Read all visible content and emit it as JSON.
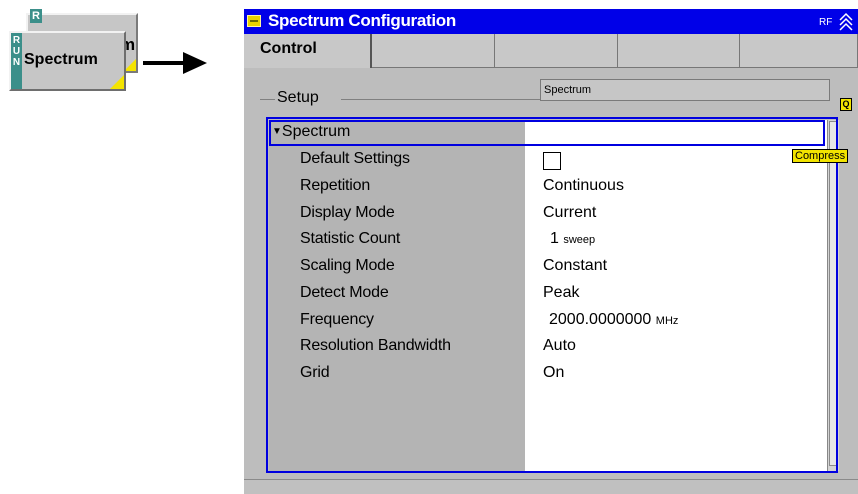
{
  "softkey": {
    "back_tail": "m",
    "back_letter": "R",
    "run_letters": [
      "R",
      "U",
      "N"
    ],
    "label": "Spectrum"
  },
  "window": {
    "title": "Spectrum Configuration",
    "rf_label": "RF",
    "tabs": [
      "Control",
      "",
      "",
      "",
      ""
    ]
  },
  "setup": {
    "label": "Setup",
    "value": "Spectrum",
    "q_badge": "Q"
  },
  "tree": {
    "node_label": "Spectrum",
    "compress_label": "Compress",
    "rows": [
      {
        "label": "Default Settings",
        "value": ""
      },
      {
        "label": "Repetition",
        "value": "Continuous"
      },
      {
        "label": "Display Mode",
        "value": "Current"
      },
      {
        "label": "Statistic Count",
        "value": "1",
        "unit": "sweep"
      },
      {
        "label": "Scaling Mode",
        "value": "Constant"
      },
      {
        "label": "Detect Mode",
        "value": "Peak"
      },
      {
        "label": "Frequency",
        "value": "2000.0000000",
        "unit": "MHz"
      },
      {
        "label": "Resolution Bandwidth",
        "value": "Auto"
      },
      {
        "label": "Grid",
        "value": "On"
      }
    ]
  },
  "colors": {
    "title_bar": "#0000e8",
    "accent_yellow": "#f2e400",
    "run_teal": "#3b8f8a"
  }
}
